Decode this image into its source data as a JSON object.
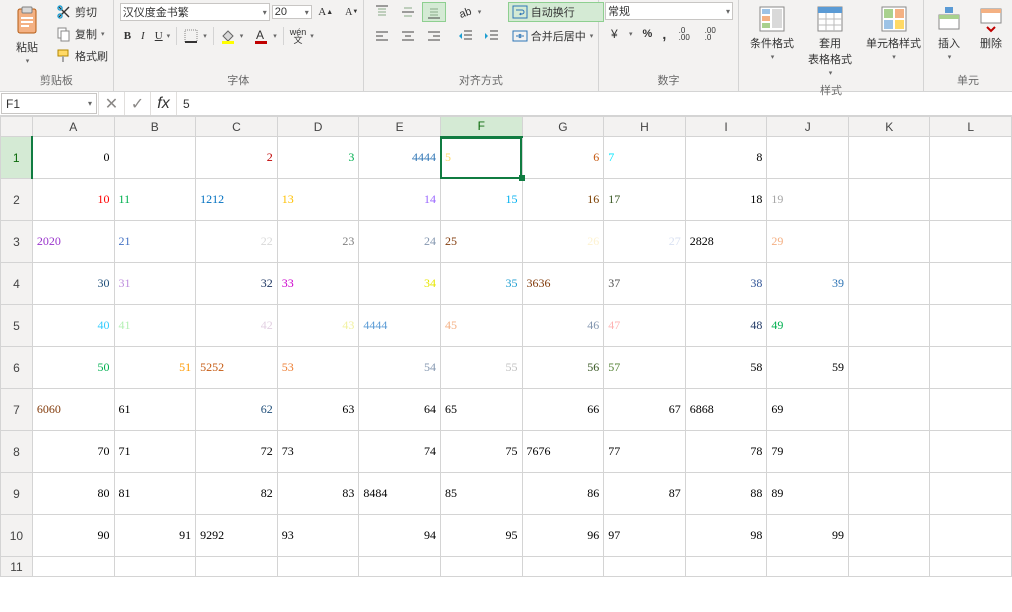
{
  "ribbon": {
    "clipboard": {
      "label": "剪贴板",
      "paste": "粘贴",
      "cut": "剪切",
      "copy": "复制",
      "format_painter": "格式刷"
    },
    "font": {
      "label": "字体",
      "family": "汉仪度金书繁",
      "size": "20",
      "bold": "B",
      "italic": "I",
      "underline": "U",
      "phonetic": "wén 文"
    },
    "align": {
      "label": "对齐方式",
      "wrap": "自动换行",
      "merge": "合并后居中"
    },
    "number": {
      "label": "数字",
      "format": "常规",
      "percent": "%",
      "comma": ",",
      "inc": ".00→.0",
      "dec": ".0→.00"
    },
    "styles": {
      "label": "样式",
      "cond": "条件格式",
      "table": "套用\n表格格式",
      "cell": "单元格样式"
    },
    "cells": {
      "label": "单元",
      "insert": "插入",
      "delete": "删除"
    }
  },
  "formula_bar": {
    "name_box": "F1",
    "fx": "fx",
    "value": "5"
  },
  "sheet": {
    "columns": [
      "A",
      "B",
      "C",
      "D",
      "E",
      "F",
      "G",
      "H",
      "I",
      "J",
      "K",
      "L"
    ],
    "active": {
      "row": 1,
      "col": "F"
    },
    "rows": [
      {
        "n": 1,
        "cells": [
          {
            "v": "0",
            "c": "#000",
            "a": "right"
          },
          {
            "v": "",
            "c": "#000",
            "a": "right"
          },
          {
            "v": "2",
            "c": "#c00000",
            "a": "right"
          },
          {
            "v": "3",
            "c": "#00b050",
            "a": "right"
          },
          {
            "v": "4444",
            "c": "#2f75b5",
            "a": "right"
          },
          {
            "v": "5",
            "c": "#ffd966",
            "a": "left"
          },
          {
            "v": "6",
            "c": "#c65911",
            "a": "right"
          },
          {
            "v": "7",
            "c": "#00e6ff",
            "a": "left"
          },
          {
            "v": "8",
            "c": "#000",
            "a": "right"
          },
          {
            "v": "",
            "c": "#000",
            "a": "right"
          },
          {
            "v": "",
            "c": "#000",
            "a": "right"
          },
          {
            "v": "",
            "c": "#000",
            "a": "right"
          }
        ]
      },
      {
        "n": 2,
        "cells": [
          {
            "v": "10",
            "c": "#ff0000",
            "a": "right"
          },
          {
            "v": "11",
            "c": "#00b050",
            "a": "left"
          },
          {
            "v": "1212",
            "c": "#0070c0",
            "a": "left"
          },
          {
            "v": "13",
            "c": "#ffc000",
            "a": "left"
          },
          {
            "v": "14",
            "c": "#9966ff",
            "a": "right"
          },
          {
            "v": "15",
            "c": "#00b0f0",
            "a": "right"
          },
          {
            "v": "16",
            "c": "#7b3f00",
            "a": "right"
          },
          {
            "v": "17",
            "c": "#385723",
            "a": "left"
          },
          {
            "v": "18",
            "c": "#000",
            "a": "right"
          },
          {
            "v": "19",
            "c": "#a6a6a6",
            "a": "left"
          },
          {
            "v": "",
            "c": "#000",
            "a": "right"
          },
          {
            "v": "",
            "c": "#000",
            "a": "right"
          }
        ]
      },
      {
        "n": 3,
        "cells": [
          {
            "v": "2020",
            "c": "#9933cc",
            "a": "left"
          },
          {
            "v": "21",
            "c": "#4472c4",
            "a": "left"
          },
          {
            "v": "22",
            "c": "#d9d9d9",
            "a": "right"
          },
          {
            "v": "23",
            "c": "#808080",
            "a": "right"
          },
          {
            "v": "24",
            "c": "#8497b0",
            "a": "right"
          },
          {
            "v": "25",
            "c": "#833c0c",
            "a": "left"
          },
          {
            "v": "26",
            "c": "#fdf2d0",
            "a": "right"
          },
          {
            "v": "27",
            "c": "#d9e1f2",
            "a": "right"
          },
          {
            "v": "2828",
            "c": "#000",
            "a": "left"
          },
          {
            "v": "29",
            "c": "#f4b084",
            "a": "left"
          },
          {
            "v": "",
            "c": "#000",
            "a": "right"
          },
          {
            "v": "",
            "c": "#000",
            "a": "right"
          }
        ]
      },
      {
        "n": 4,
        "cells": [
          {
            "v": "30",
            "c": "#1f4e79",
            "a": "right"
          },
          {
            "v": "31",
            "c": "#bf8fde",
            "a": "left"
          },
          {
            "v": "32",
            "c": "#203864",
            "a": "right"
          },
          {
            "v": "33",
            "c": "#cc00cc",
            "a": "left"
          },
          {
            "v": "34",
            "c": "#e6e600",
            "a": "right"
          },
          {
            "v": "35",
            "c": "#1f9ed1",
            "a": "right"
          },
          {
            "v": "3636",
            "c": "#833c0c",
            "a": "left"
          },
          {
            "v": "37",
            "c": "#525252",
            "a": "left"
          },
          {
            "v": "38",
            "c": "#305496",
            "a": "right"
          },
          {
            "v": "39",
            "c": "#2f75b5",
            "a": "right"
          },
          {
            "v": "",
            "c": "#000",
            "a": "right"
          },
          {
            "v": "",
            "c": "#000",
            "a": "right"
          }
        ]
      },
      {
        "n": 5,
        "cells": [
          {
            "v": "40",
            "c": "#33ccff",
            "a": "right"
          },
          {
            "v": "41",
            "c": "#b4f0b4",
            "a": "left"
          },
          {
            "v": "42",
            "c": "#e2cfe2",
            "a": "right"
          },
          {
            "v": "43",
            "c": "#f2f2a0",
            "a": "right"
          },
          {
            "v": "4444",
            "c": "#5b9bd5",
            "a": "left"
          },
          {
            "v": "45",
            "c": "#f4b084",
            "a": "left"
          },
          {
            "v": "46",
            "c": "#8497b0",
            "a": "right"
          },
          {
            "v": "47",
            "c": "#ffb3b3",
            "a": "left"
          },
          {
            "v": "48",
            "c": "#203864",
            "a": "right"
          },
          {
            "v": "49",
            "c": "#00b050",
            "a": "left"
          },
          {
            "v": "",
            "c": "#000",
            "a": "right"
          },
          {
            "v": "",
            "c": "#000",
            "a": "right"
          }
        ]
      },
      {
        "n": 6,
        "cells": [
          {
            "v": "50",
            "c": "#00b050",
            "a": "right"
          },
          {
            "v": "51",
            "c": "#ff9900",
            "a": "right"
          },
          {
            "v": "5252",
            "c": "#c55a11",
            "a": "left"
          },
          {
            "v": "53",
            "c": "#ed7d31",
            "a": "left"
          },
          {
            "v": "54",
            "c": "#8497b0",
            "a": "right"
          },
          {
            "v": "55",
            "c": "#bfbfbf",
            "a": "right"
          },
          {
            "v": "56",
            "c": "#385723",
            "a": "right"
          },
          {
            "v": "57",
            "c": "#548235",
            "a": "left"
          },
          {
            "v": "58",
            "c": "#000",
            "a": "right"
          },
          {
            "v": "59",
            "c": "#000",
            "a": "right"
          },
          {
            "v": "",
            "c": "#000",
            "a": "right"
          },
          {
            "v": "",
            "c": "#000",
            "a": "right"
          }
        ]
      },
      {
        "n": 7,
        "cells": [
          {
            "v": "6060",
            "c": "#833c0c",
            "a": "left"
          },
          {
            "v": "61",
            "c": "#000",
            "a": "left"
          },
          {
            "v": "62",
            "c": "#1f4e79",
            "a": "right"
          },
          {
            "v": "63",
            "c": "#000",
            "a": "right"
          },
          {
            "v": "64",
            "c": "#000",
            "a": "right"
          },
          {
            "v": "65",
            "c": "#000",
            "a": "left"
          },
          {
            "v": "66",
            "c": "#000",
            "a": "right"
          },
          {
            "v": "67",
            "c": "#000",
            "a": "right"
          },
          {
            "v": "6868",
            "c": "#000",
            "a": "left"
          },
          {
            "v": "69",
            "c": "#000",
            "a": "left"
          },
          {
            "v": "",
            "c": "#000",
            "a": "right"
          },
          {
            "v": "",
            "c": "#000",
            "a": "right"
          }
        ]
      },
      {
        "n": 8,
        "cells": [
          {
            "v": "70",
            "c": "#000",
            "a": "right"
          },
          {
            "v": "71",
            "c": "#000",
            "a": "left"
          },
          {
            "v": "72",
            "c": "#000",
            "a": "right"
          },
          {
            "v": "73",
            "c": "#000",
            "a": "left"
          },
          {
            "v": "74",
            "c": "#000",
            "a": "right"
          },
          {
            "v": "75",
            "c": "#000",
            "a": "right"
          },
          {
            "v": "7676",
            "c": "#000",
            "a": "left"
          },
          {
            "v": "77",
            "c": "#000",
            "a": "left"
          },
          {
            "v": "78",
            "c": "#000",
            "a": "right"
          },
          {
            "v": "79",
            "c": "#000",
            "a": "left"
          },
          {
            "v": "",
            "c": "#000",
            "a": "right"
          },
          {
            "v": "",
            "c": "#000",
            "a": "right"
          }
        ]
      },
      {
        "n": 9,
        "cells": [
          {
            "v": "80",
            "c": "#000",
            "a": "right"
          },
          {
            "v": "81",
            "c": "#000",
            "a": "left"
          },
          {
            "v": "82",
            "c": "#000",
            "a": "right"
          },
          {
            "v": "83",
            "c": "#000",
            "a": "right"
          },
          {
            "v": "8484",
            "c": "#000",
            "a": "left"
          },
          {
            "v": "85",
            "c": "#000",
            "a": "left"
          },
          {
            "v": "86",
            "c": "#000",
            "a": "right"
          },
          {
            "v": "87",
            "c": "#000",
            "a": "right"
          },
          {
            "v": "88",
            "c": "#000",
            "a": "right"
          },
          {
            "v": "89",
            "c": "#000",
            "a": "left"
          },
          {
            "v": "",
            "c": "#000",
            "a": "right"
          },
          {
            "v": "",
            "c": "#000",
            "a": "right"
          }
        ]
      },
      {
        "n": 10,
        "cells": [
          {
            "v": "90",
            "c": "#000",
            "a": "right"
          },
          {
            "v": "91",
            "c": "#000",
            "a": "right"
          },
          {
            "v": "9292",
            "c": "#000",
            "a": "left"
          },
          {
            "v": "93",
            "c": "#000",
            "a": "left"
          },
          {
            "v": "94",
            "c": "#000",
            "a": "right"
          },
          {
            "v": "95",
            "c": "#000",
            "a": "right"
          },
          {
            "v": "96",
            "c": "#000",
            "a": "right"
          },
          {
            "v": "97",
            "c": "#000",
            "a": "left"
          },
          {
            "v": "98",
            "c": "#000",
            "a": "right"
          },
          {
            "v": "99",
            "c": "#000",
            "a": "right"
          },
          {
            "v": "",
            "c": "#000",
            "a": "right"
          },
          {
            "v": "",
            "c": "#000",
            "a": "right"
          }
        ]
      },
      {
        "n": 11,
        "cells": [
          {
            "v": "",
            "c": "#000",
            "a": "right"
          },
          {
            "v": "",
            "c": "#000",
            "a": "right"
          },
          {
            "v": "",
            "c": "#000",
            "a": "right"
          },
          {
            "v": "",
            "c": "#000",
            "a": "right"
          },
          {
            "v": "",
            "c": "#000",
            "a": "right"
          },
          {
            "v": "",
            "c": "#000",
            "a": "right"
          },
          {
            "v": "",
            "c": "#000",
            "a": "right"
          },
          {
            "v": "",
            "c": "#000",
            "a": "right"
          },
          {
            "v": "",
            "c": "#000",
            "a": "right"
          },
          {
            "v": "",
            "c": "#000",
            "a": "right"
          },
          {
            "v": "",
            "c": "#000",
            "a": "right"
          },
          {
            "v": "",
            "c": "#000",
            "a": "right"
          }
        ]
      }
    ]
  }
}
